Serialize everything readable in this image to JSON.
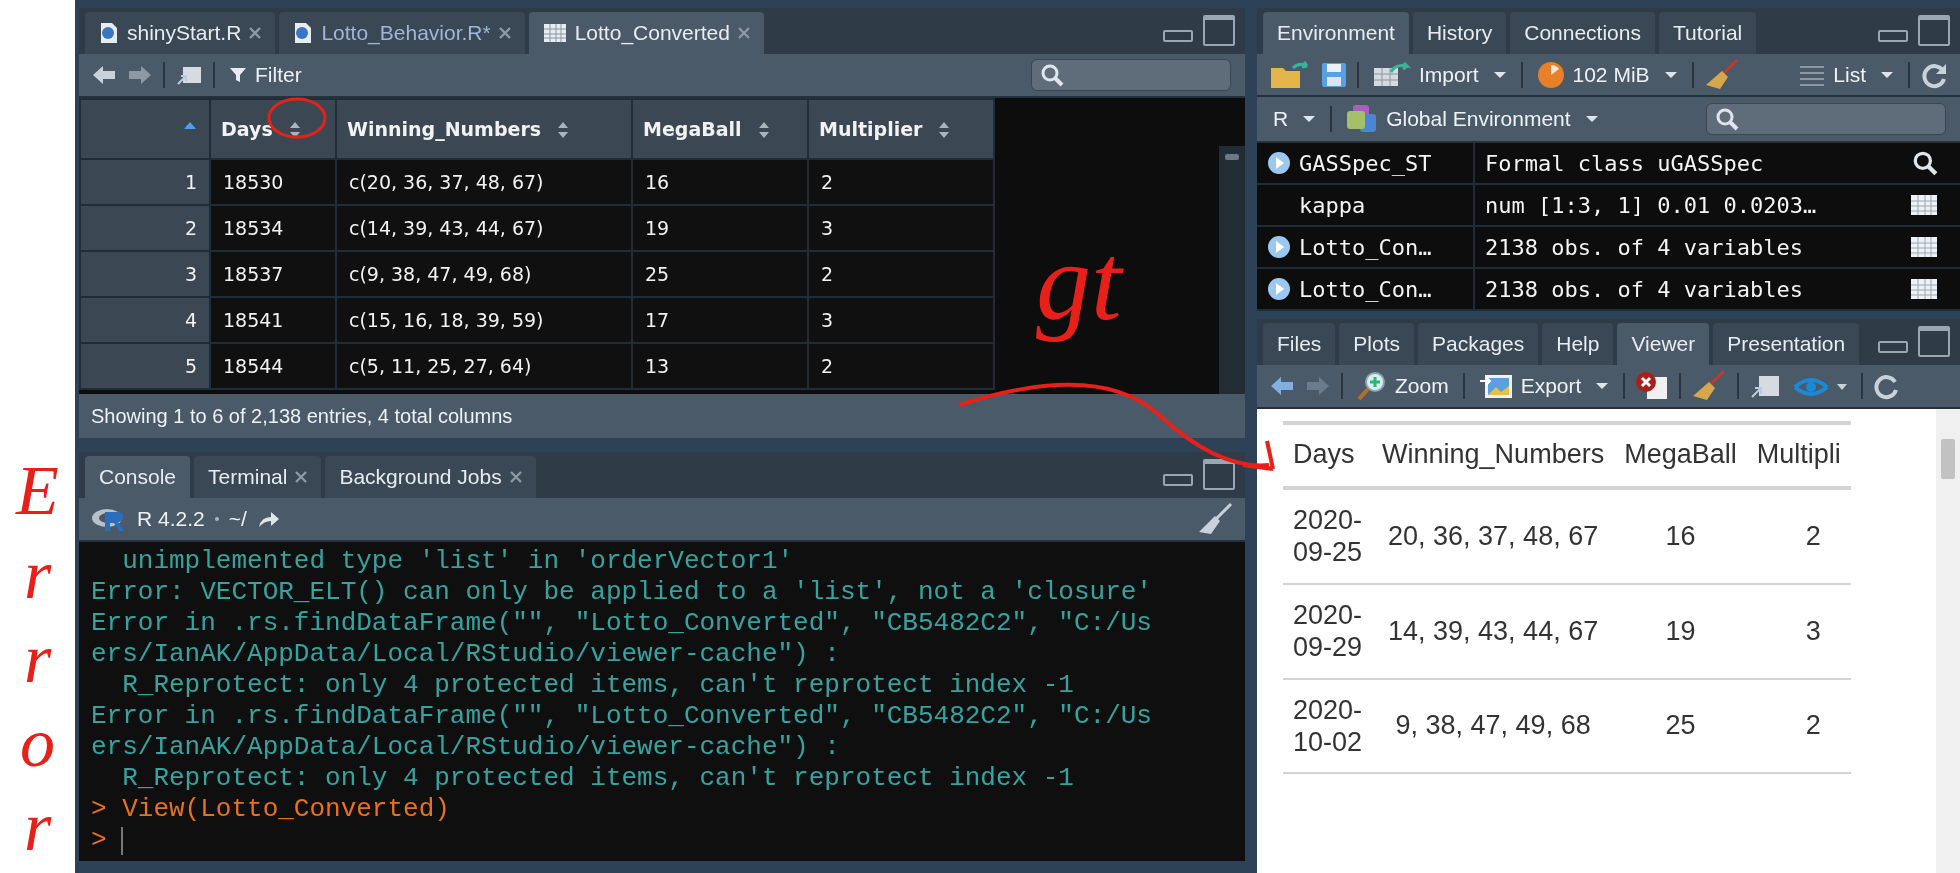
{
  "annotations": {
    "side_note": "Error",
    "arrow_note": "gt"
  },
  "source_pane": {
    "tabs": [
      {
        "label": "shinyStart.R",
        "kind": "script",
        "selected": false
      },
      {
        "label": "Lotto_Behavior.R*",
        "kind": "script",
        "selected": false
      },
      {
        "label": "Lotto_Converted",
        "kind": "data",
        "selected": true
      }
    ],
    "filter": "Filter",
    "columns": [
      "Days",
      "Winning_Numbers",
      "MegaBall",
      "Multiplier"
    ],
    "rows": [
      {
        "index": "1",
        "cells": [
          "18530",
          "c(20, 36, 37, 48, 67)",
          "16",
          "2"
        ]
      },
      {
        "index": "2",
        "cells": [
          "18534",
          "c(14, 39, 43, 44, 67)",
          "19",
          "3"
        ]
      },
      {
        "index": "3",
        "cells": [
          "18537",
          "c(9, 38, 47, 49, 68)",
          "25",
          "2"
        ]
      },
      {
        "index": "4",
        "cells": [
          "18541",
          "c(15, 16, 18, 39, 59)",
          "17",
          "3"
        ]
      },
      {
        "index": "5",
        "cells": [
          "18544",
          "c(5, 11, 25, 27, 64)",
          "13",
          "2"
        ]
      }
    ],
    "status": "Showing 1 to 6 of 2,138 entries, 4 total columns"
  },
  "console_pane": {
    "tabs": [
      {
        "label": "Console",
        "selected": true,
        "closable": false
      },
      {
        "label": "Terminal",
        "selected": false,
        "closable": true
      },
      {
        "label": "Background Jobs",
        "selected": false,
        "closable": true
      }
    ],
    "version": "R 4.2.2",
    "path": "~/",
    "lines": [
      {
        "kind": "output",
        "text": "  unimplemented type 'list' in 'orderVector1'"
      },
      {
        "kind": "output",
        "text": "Error: VECTOR_ELT() can only be applied to a 'list', not a 'closure'"
      },
      {
        "kind": "output",
        "text": "Error in .rs.findDataFrame(\"\", \"Lotto_Converted\", \"CB5482C2\", \"C:/Us"
      },
      {
        "kind": "output",
        "text": "ers/IanAK/AppData/Local/RStudio/viewer-cache\") :"
      },
      {
        "kind": "output",
        "text": "  R_Reprotect: only 4 protected items, can't reprotect index -1"
      },
      {
        "kind": "output",
        "text": "Error in .rs.findDataFrame(\"\", \"Lotto_Converted\", \"CB5482C2\", \"C:/Us"
      },
      {
        "kind": "output",
        "text": "ers/IanAK/AppData/Local/RStudio/viewer-cache\") :"
      },
      {
        "kind": "output",
        "text": "  R_Reprotect: only 4 protected items, can't reprotect index -1"
      },
      {
        "kind": "input",
        "text": "> View(Lotto_Converted)"
      },
      {
        "kind": "prompt",
        "text": ">"
      }
    ]
  },
  "environment_pane": {
    "tabs": [
      {
        "label": "Environment",
        "selected": true
      },
      {
        "label": "History",
        "selected": false
      },
      {
        "label": "Connections",
        "selected": false
      },
      {
        "label": "Tutorial",
        "selected": false
      }
    ],
    "import": "Import",
    "memory": "102 MiB",
    "view": "List",
    "language": "R",
    "scope": "Global Environment",
    "rows": [
      {
        "name": "GASSpec_ST",
        "value": "Formal class  uGASSpec",
        "expandable": true,
        "kind": "search"
      },
      {
        "name": "kappa",
        "value": "num [1:3, 1] 0.01 0.0203…",
        "expandable": false,
        "kind": "grid"
      },
      {
        "name": "Lotto_Con…",
        "value": "2138 obs. of 4 variables",
        "expandable": true,
        "kind": "grid"
      },
      {
        "name": "Lotto_Con…",
        "value": "2138 obs. of 4 variables",
        "expandable": true,
        "kind": "grid"
      }
    ]
  },
  "viewer_pane": {
    "tabs": [
      {
        "label": "Files",
        "selected": false
      },
      {
        "label": "Plots",
        "selected": false
      },
      {
        "label": "Packages",
        "selected": false
      },
      {
        "label": "Help",
        "selected": false
      },
      {
        "label": "Viewer",
        "selected": true
      },
      {
        "label": "Presentation",
        "selected": false
      }
    ],
    "zoom": "Zoom",
    "export": "Export",
    "columns": [
      "Days",
      "Winning_Numbers",
      "MegaBall",
      "Multipli"
    ],
    "rows": [
      {
        "cells": [
          "2020-09-25",
          "20, 36, 37, 48, 67",
          "16",
          "2"
        ]
      },
      {
        "cells": [
          "2020-09-29",
          "14, 39, 43, 44, 67",
          "19",
          "3"
        ]
      },
      {
        "cells": [
          "2020-10-02",
          "9, 38, 47, 49, 68",
          "25",
          "2"
        ]
      }
    ]
  }
}
